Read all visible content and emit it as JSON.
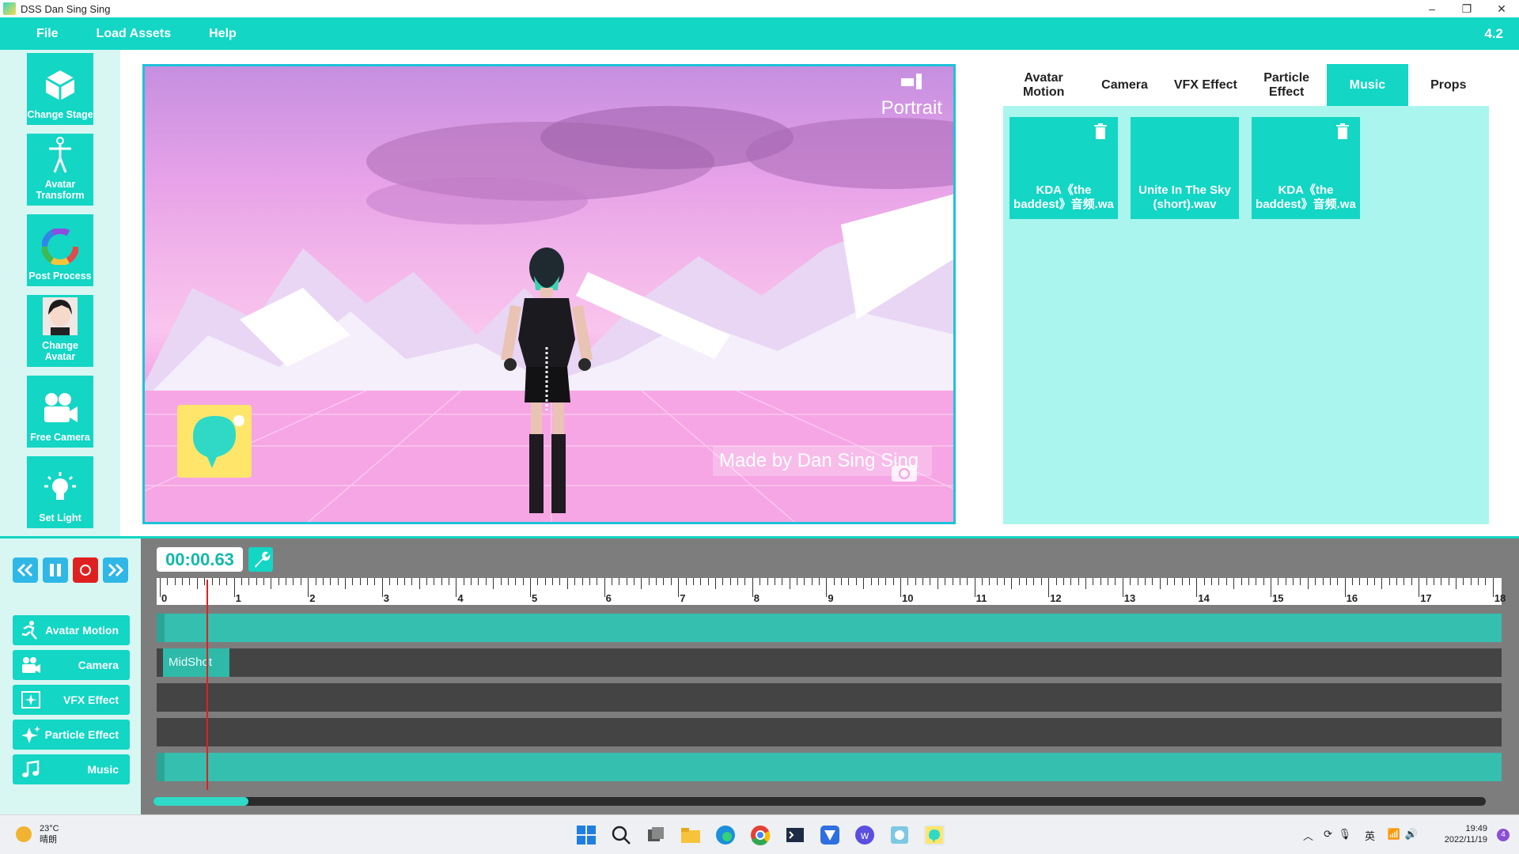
{
  "window": {
    "title": "DSS Dan Sing Sing",
    "minimize": "–",
    "maximize": "❐",
    "close": "✕"
  },
  "menu": {
    "items": [
      "File",
      "Load Assets",
      "Help"
    ],
    "version": "4.2"
  },
  "tools": [
    {
      "label": "Change Stage",
      "icon": "cube-icon"
    },
    {
      "label": "Avatar Transform",
      "icon": "person-icon"
    },
    {
      "label": "Post Process",
      "icon": "color-wheel-icon"
    },
    {
      "label": "Change Avatar",
      "icon": "avatar-icon"
    },
    {
      "label": "Free Camera",
      "icon": "camera-icon"
    },
    {
      "label": "Set Light",
      "icon": "lightbulb-icon"
    }
  ],
  "viewport": {
    "orientation_label": "Portrait",
    "watermark": "Made by Dan Sing Sing"
  },
  "panel": {
    "tabs": [
      "Avatar Motion",
      "Camera",
      "VFX Effect",
      "Particle Effect",
      "Music",
      "Props"
    ],
    "active_tab": "Music",
    "cards": [
      {
        "label": "KDA《the baddest》音频.wa",
        "has_trash": true
      },
      {
        "label": "Unite In The Sky (short).wav",
        "has_trash": false
      },
      {
        "label": "KDA《the baddest》音频.wa",
        "has_trash": true
      }
    ]
  },
  "timeline": {
    "time": "00:00.63",
    "ruler_ticks": [
      "0",
      "1",
      "2",
      "3",
      "4",
      "5",
      "6",
      "7",
      "8",
      "9",
      "10",
      "11",
      "12",
      "13",
      "14",
      "15",
      "16",
      "17",
      "18"
    ],
    "tracks": [
      {
        "label": "Avatar Motion",
        "icon": "running-person-icon"
      },
      {
        "label": "Camera",
        "icon": "camera-icon"
      },
      {
        "label": "VFX Effect",
        "icon": "sparkle-frame-icon"
      },
      {
        "label": "Particle Effect",
        "icon": "particles-icon"
      },
      {
        "label": "Music",
        "icon": "music-note-icon"
      }
    ],
    "camera_clip": "MidShot",
    "playhead_seconds": 0.63
  },
  "taskbar": {
    "temp": "23°C",
    "weather": "晴朗",
    "time": "19:49",
    "date": "2022/11/19",
    "ime": "英",
    "notif": "4"
  },
  "colors": {
    "accent": "#13d6c4",
    "panel_bg": "#aaf6ee",
    "record": "#e02020"
  }
}
